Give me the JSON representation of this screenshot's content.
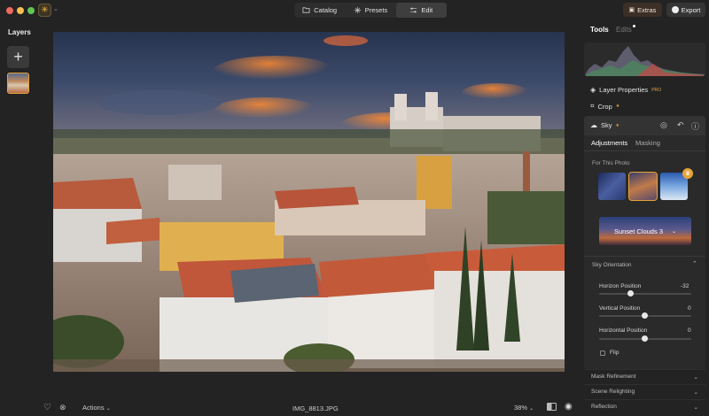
{
  "window": {
    "traffic_colors": [
      "#ed6a5e",
      "#f5bf4f",
      "#61c554"
    ]
  },
  "modes": [
    {
      "label": "Catalog",
      "icon": "folder-icon",
      "active": false
    },
    {
      "label": "Presets",
      "icon": "sparkle-icon",
      "active": false
    },
    {
      "label": "Edit",
      "icon": "sliders-icon",
      "active": true
    }
  ],
  "header": {
    "extras_label": "Extras",
    "export_label": "Export"
  },
  "layers": {
    "title": "Layers",
    "add_symbol": "+"
  },
  "bottom": {
    "actions_label": "Actions",
    "filename": "IMG_8813.JPG",
    "zoom": "38%"
  },
  "panel": {
    "tools_tab": "Tools",
    "edits_tab": "Edits",
    "layer_properties": "Layer Properties",
    "layer_properties_badge": "PRO",
    "crop": "Crop",
    "sky": {
      "title": "Sky",
      "tabs": [
        "Adjustments",
        "Masking"
      ],
      "for_this_photo": "For This Photo",
      "selected_sky": "Sunset Clouds 3",
      "orientation_title": "Sky Orientation",
      "sliders": [
        {
          "label": "Horizon Position",
          "value": "-32",
          "fraction": 0.34
        },
        {
          "label": "Vertical Position",
          "value": "0",
          "fraction": 0.5
        },
        {
          "label": "Horizontal Position",
          "value": "0",
          "fraction": 0.5
        }
      ],
      "flip_label": "Flip"
    },
    "sections": [
      "Mask Refinement",
      "Scene Relighting",
      "Reflection"
    ]
  },
  "colors": {
    "accent": "#e7a33b",
    "panel_bg": "#232323"
  }
}
